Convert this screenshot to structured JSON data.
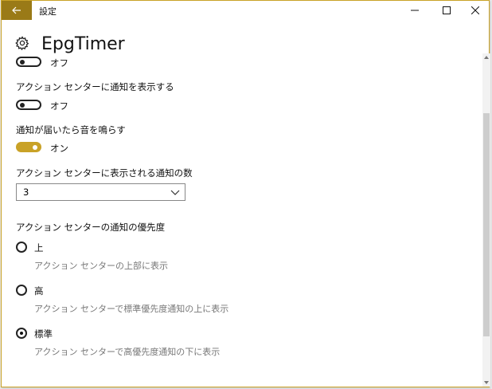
{
  "window": {
    "title": "設定",
    "app_name": "EpgTimer"
  },
  "settings": {
    "prev_toggle_state": "オフ",
    "action_center_notify": {
      "label": "アクション センターに通知を表示する",
      "state": "オフ",
      "on": false
    },
    "sound_notify": {
      "label": "通知が届いたら音を鳴らす",
      "state": "オン",
      "on": true
    },
    "notify_count": {
      "label": "アクション センターに表示される通知の数",
      "value": "3"
    },
    "priority": {
      "label": "アクション センターの通知の優先度",
      "options": [
        {
          "label": "上",
          "desc": "アクション センターの上部に表示",
          "checked": false
        },
        {
          "label": "高",
          "desc": "アクション センターで標準優先度通知の上に表示",
          "checked": false
        },
        {
          "label": "標準",
          "desc": "アクション センターで高優先度通知の下に表示",
          "checked": true
        }
      ]
    }
  },
  "scroll": {
    "position": 0.55
  },
  "colors": {
    "accent": "#c9a227",
    "back_button": "#9a7a17"
  },
  "icons": [
    "back-arrow-icon",
    "minimize-icon",
    "maximize-icon",
    "close-icon",
    "gear-icon",
    "chevron-down-icon"
  ]
}
